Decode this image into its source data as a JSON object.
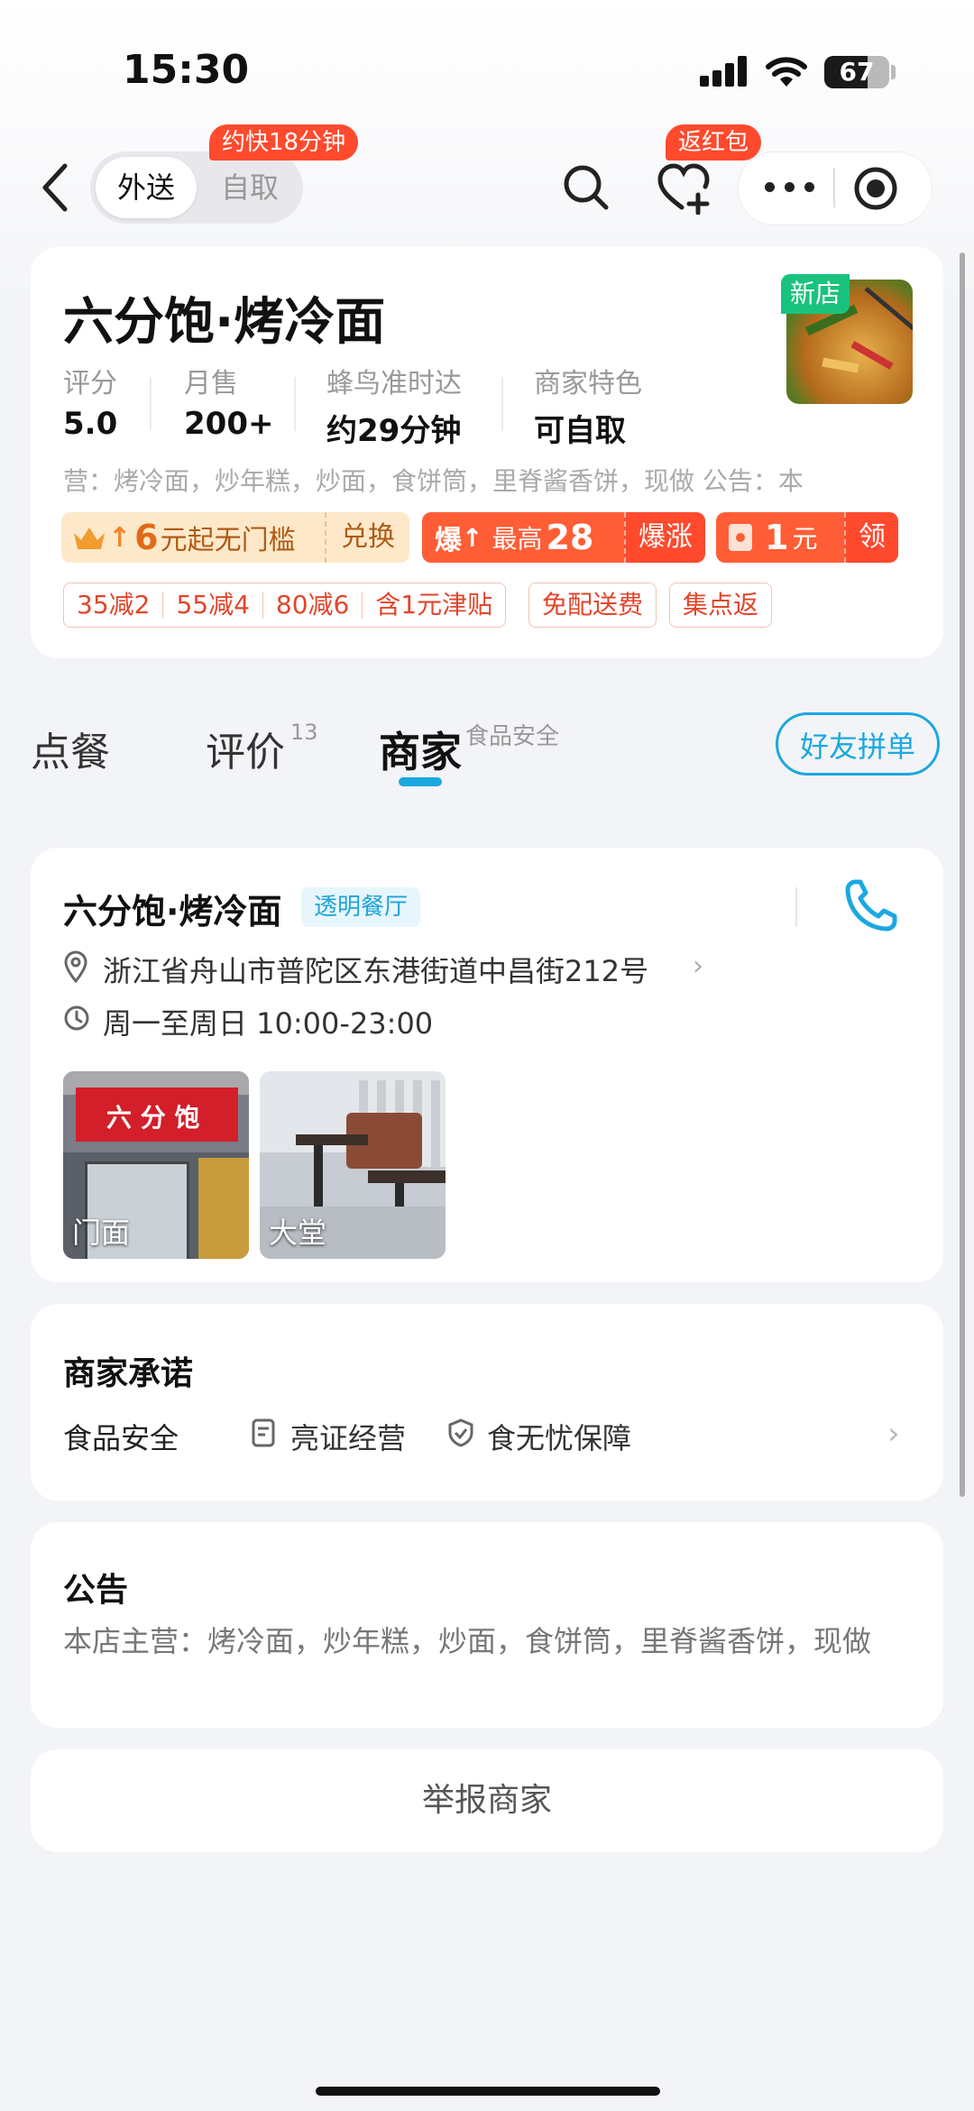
{
  "status_bar": {
    "time": "15:30",
    "battery": "67",
    "battery_level": 0.67
  },
  "nav": {
    "mode_active": "外送",
    "mode_inactive": "自取",
    "mode_badge": "约快18分钟",
    "favorite_badge": "返红包"
  },
  "store": {
    "name": "六分饱·烤冷面",
    "new_tag": "新店",
    "stats": [
      {
        "label": "评分",
        "value": "5.0"
      },
      {
        "label": "月售",
        "value": "200+"
      },
      {
        "label": "蜂鸟准时达",
        "value": "约29分钟"
      },
      {
        "label": "商家特色",
        "value": "可自取"
      }
    ],
    "scroll_text": "营：烤冷面，炒年糕，炒面，食饼筒，里脊酱香饼，现做    公告：本",
    "coupons": {
      "c1_num": "6",
      "c1_text": "元起无门槛",
      "c1_action": "兑换",
      "c2_icon": "爆",
      "c2_text": "最高",
      "c2_num": "28",
      "c2_action": "爆涨",
      "c3_num": "1",
      "c3_unit": "元",
      "c3_action": "领"
    },
    "discounts": [
      "35减2",
      "55减4",
      "80减6",
      "含1元津贴"
    ],
    "extra_tags": [
      "免配送费",
      "集点返"
    ]
  },
  "tabs": {
    "order": "点餐",
    "reviews": "评价",
    "reviews_count": "13",
    "merchant": "商家",
    "merchant_sup": "食品安全",
    "group_button": "好友拼单"
  },
  "merchant_info": {
    "name": "六分饱·烤冷面",
    "tag": "透明餐厅",
    "address": "浙江省舟山市普陀区东港街道中昌街212号",
    "hours": "周一至周日 10:00-23:00",
    "photos": [
      {
        "caption": "门面"
      },
      {
        "caption": "大堂"
      }
    ],
    "sign_text": "六 分 饱"
  },
  "commitment": {
    "title": "商家承诺",
    "label": "食品安全",
    "items": [
      "亮证经营",
      "食无忧保障"
    ]
  },
  "notice": {
    "title": "公告",
    "text": "本店主营：烤冷面，炒年糕，炒面，食饼筒，里脊酱香饼，现做"
  },
  "report_button": "举报商家",
  "colors": {
    "brand_blue": "#1ba8e0",
    "red": "#ff4a2e",
    "new_tag_green": "#19c37d"
  }
}
